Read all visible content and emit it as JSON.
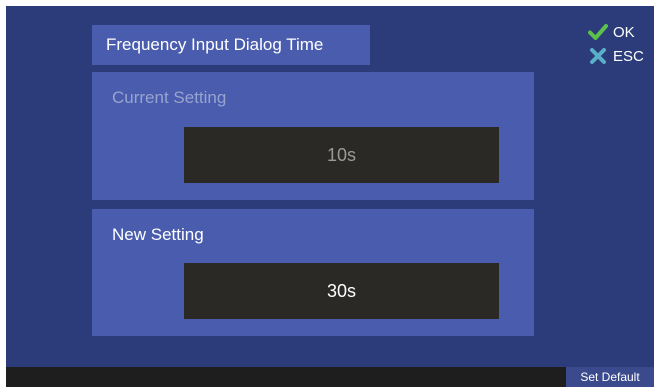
{
  "dialog": {
    "title": "Frequency Input Dialog Time"
  },
  "actions": {
    "ok": {
      "label": "OK",
      "icon": "check-icon",
      "color": "#5cc04a"
    },
    "esc": {
      "label": "ESC",
      "icon": "close-icon",
      "color": "#5ab0c8"
    }
  },
  "current_setting": {
    "label": "Current Setting",
    "value": "10s"
  },
  "new_setting": {
    "label": "New Setting",
    "value": "30s"
  },
  "footer": {
    "set_default_label": "Set Default"
  },
  "colors": {
    "background": "#2c3c7a",
    "panel": "#4a5cae",
    "value_box": "#2b2926",
    "footer": "#1e1e1e"
  }
}
